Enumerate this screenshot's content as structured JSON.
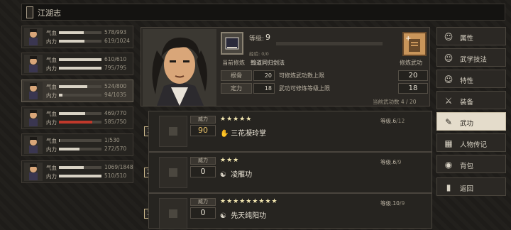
{
  "header": {
    "title": "江湖志"
  },
  "party": [
    {
      "hp_label": "气血",
      "hp": "578/993",
      "hp_frac": 0.58,
      "mp_label": "内力",
      "mp": "619/1024",
      "mp_frac": 0.6,
      "hp_color": "#d8d2c4",
      "mp_color": "#d8d2c4"
    },
    {
      "hp_label": "气血",
      "hp": "610/610",
      "hp_frac": 1.0,
      "mp_label": "内力",
      "mp": "795/795",
      "mp_frac": 1.0,
      "hp_color": "#d8d2c4",
      "mp_color": "#d8d2c4"
    },
    {
      "hp_label": "气血",
      "hp": "524/800",
      "hp_frac": 0.66,
      "mp_label": "内力",
      "mp": "94/1035",
      "mp_frac": 0.09,
      "hp_color": "#d8d2c4",
      "mp_color": "#d8d2c4"
    },
    {
      "hp_label": "气血",
      "hp": "469/770",
      "hp_frac": 0.61,
      "mp_label": "内力",
      "mp": "585/750",
      "mp_frac": 0.78,
      "hp_color": "#d8d2c4",
      "mp_color": "#c0392b"
    },
    {
      "hp_label": "气血",
      "hp": "1/530",
      "hp_frac": 0.01,
      "mp_label": "内力",
      "mp": "272/570",
      "mp_frac": 0.48,
      "hp_color": "#d8d2c4",
      "mp_color": "#d8d2c4"
    },
    {
      "hp_label": "气血",
      "hp": "1069/1848",
      "hp_frac": 0.58,
      "mp_label": "内力",
      "mp": "510/510",
      "mp_frac": 1.0,
      "hp_color": "#d8d2c4",
      "mp_color": "#d8d2c4"
    }
  ],
  "info": {
    "level_label": "等级:",
    "level_value": "9",
    "exp_label": "经验: 0/0",
    "practice_label": "当前修炼",
    "practice_value": "翰道同归剑法",
    "practice_button_label": "修炼武功",
    "attrs": [
      {
        "key": "根骨",
        "val": "20",
        "desc": "可修炼武功数上限",
        "right": "20"
      },
      {
        "key": "定力",
        "val": "18",
        "desc": "武功可修炼等级上限",
        "right": "18"
      }
    ],
    "current_count": "当前武功数     4 / 20"
  },
  "skills": [
    {
      "num": "1",
      "power_label": "威力",
      "power": "90",
      "power_color": "#e8c26a",
      "stars": "★★★★★",
      "level": "等级.6",
      "level_max": "/12",
      "name": "三花凝玲掌",
      "icon": "✋"
    },
    {
      "num": "2",
      "power_label": "威力",
      "power": "0",
      "power_color": "#e8e2d4",
      "stars": "★★★",
      "level": "等级.6",
      "level_max": "/9",
      "name": "凌雁功",
      "icon": "☯"
    },
    {
      "num": "3",
      "power_label": "威力",
      "power": "0",
      "power_color": "#e8e2d4",
      "stars": "★★★★★★★★★",
      "level": "等级.10",
      "level_max": "/9",
      "name": "先天纯阳功",
      "icon": "☯"
    }
  ],
  "menu": [
    {
      "label": "属性",
      "icon": "☺",
      "selected": false
    },
    {
      "label": "武学技法",
      "icon": "☺",
      "selected": false
    },
    {
      "label": "特性",
      "icon": "☺",
      "selected": false
    },
    {
      "label": "装备",
      "icon": "⚔",
      "selected": false
    },
    {
      "label": "武功",
      "icon": "✎",
      "selected": true
    },
    {
      "label": "人物传记",
      "icon": "▦",
      "selected": false
    },
    {
      "label": "背包",
      "icon": "◉",
      "selected": false
    },
    {
      "label": "返回",
      "icon": "▮",
      "selected": false
    }
  ]
}
